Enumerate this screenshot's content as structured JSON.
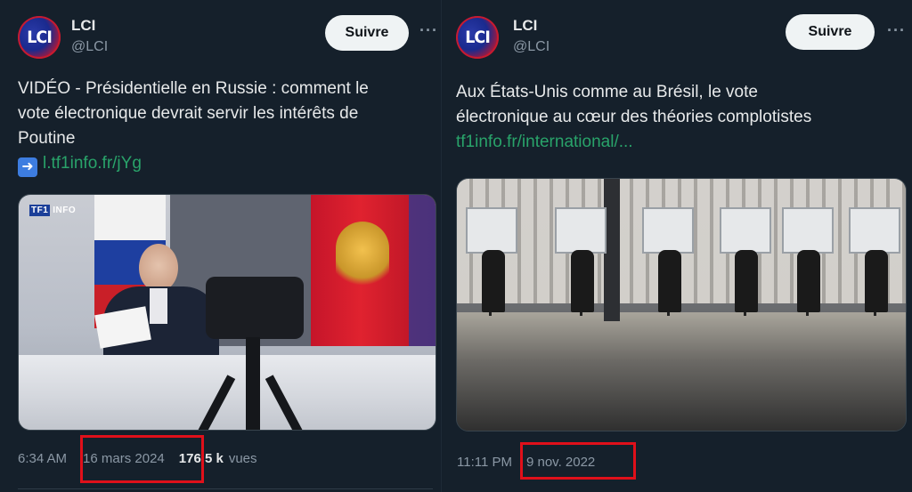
{
  "colors": {
    "background": "#15202b",
    "text": "#e7e9ea",
    "muted": "#8b98a5",
    "link_left": "#1d9bf0",
    "link_right": "#29a36a",
    "highlight": "#e0101a"
  },
  "tweets": [
    {
      "avatar_text": "LCI",
      "name": "LCI",
      "handle": "@LCI",
      "follow_label": "Suivre",
      "more_icon": "more-horizontal-icon",
      "text_lines": [
        "VIDÉO - Présidentielle en Russie : comment le",
        "vote électronique devrait servir les intérêts de",
        "Poutine"
      ],
      "link_icon": "right-arrow-emoji",
      "link_text": "l.tf1info.fr/jYg",
      "media_badge_a": "TF1",
      "media_badge_b": "INFO",
      "time": "6:34 AM",
      "date": "16 mars 2024",
      "views_count": "176,5 k",
      "views_label": "vues"
    },
    {
      "avatar_text": "LCI",
      "name": "LCI",
      "handle": "@LCI",
      "follow_label": "Suivre",
      "more_icon": "more-horizontal-icon",
      "text_lines": [
        "Aux États-Unis comme au Brésil, le vote",
        "électronique au cœur des théories complotistes"
      ],
      "link_text": "tf1info.fr/international/...",
      "time": "11:11 PM",
      "date": "9 nov. 2022"
    }
  ]
}
